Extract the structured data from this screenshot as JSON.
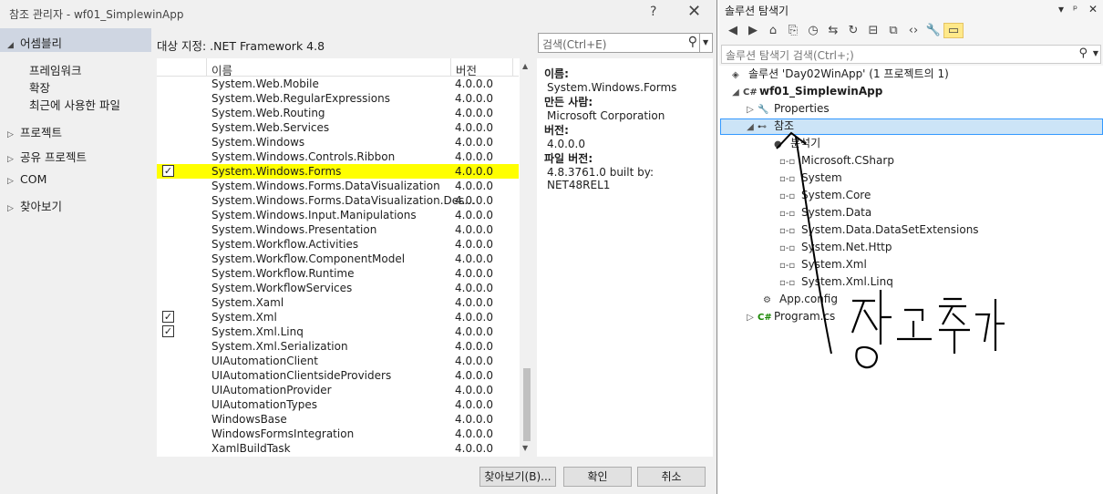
{
  "dialog": {
    "title": "참조 관리자 - wf01_SimplewinApp",
    "help": "?",
    "close": "✕",
    "left_nav": {
      "assemblies": "어셈블리",
      "framework": "프레임워크",
      "extensions": "확장",
      "recent": "최근에 사용한 파일",
      "projects": "프로젝트",
      "shared_projects": "공유 프로젝트",
      "com": "COM",
      "browse": "찾아보기"
    },
    "target_label": "대상 지정: .NET Framework 4.8",
    "search_placeholder": "검색(Ctrl+E)",
    "columns": {
      "name": "이름",
      "version": "버전"
    },
    "rows": [
      {
        "name": "System.Web.Mobile",
        "version": "4.0.0.0",
        "checked": false
      },
      {
        "name": "System.Web.RegularExpressions",
        "version": "4.0.0.0",
        "checked": false
      },
      {
        "name": "System.Web.Routing",
        "version": "4.0.0.0",
        "checked": false
      },
      {
        "name": "System.Web.Services",
        "version": "4.0.0.0",
        "checked": false
      },
      {
        "name": "System.Windows",
        "version": "4.0.0.0",
        "checked": false
      },
      {
        "name": "System.Windows.Controls.Ribbon",
        "version": "4.0.0.0",
        "checked": false
      },
      {
        "name": "System.Windows.Forms",
        "version": "4.0.0.0",
        "checked": true
      },
      {
        "name": "System.Windows.Forms.DataVisualization",
        "version": "4.0.0.0",
        "checked": false
      },
      {
        "name": "System.Windows.Forms.DataVisualization.Des...",
        "version": "4.0.0.0",
        "checked": false
      },
      {
        "name": "System.Windows.Input.Manipulations",
        "version": "4.0.0.0",
        "checked": false
      },
      {
        "name": "System.Windows.Presentation",
        "version": "4.0.0.0",
        "checked": false
      },
      {
        "name": "System.Workflow.Activities",
        "version": "4.0.0.0",
        "checked": false
      },
      {
        "name": "System.Workflow.ComponentModel",
        "version": "4.0.0.0",
        "checked": false
      },
      {
        "name": "System.Workflow.Runtime",
        "version": "4.0.0.0",
        "checked": false
      },
      {
        "name": "System.WorkflowServices",
        "version": "4.0.0.0",
        "checked": false
      },
      {
        "name": "System.Xaml",
        "version": "4.0.0.0",
        "checked": false
      },
      {
        "name": "System.Xml",
        "version": "4.0.0.0",
        "checked": true
      },
      {
        "name": "System.Xml.Linq",
        "version": "4.0.0.0",
        "checked": true
      },
      {
        "name": "System.Xml.Serialization",
        "version": "4.0.0.0",
        "checked": false
      },
      {
        "name": "UIAutomationClient",
        "version": "4.0.0.0",
        "checked": false
      },
      {
        "name": "UIAutomationClientsideProviders",
        "version": "4.0.0.0",
        "checked": false
      },
      {
        "name": "UIAutomationProvider",
        "version": "4.0.0.0",
        "checked": false
      },
      {
        "name": "UIAutomationTypes",
        "version": "4.0.0.0",
        "checked": false
      },
      {
        "name": "WindowsBase",
        "version": "4.0.0.0",
        "checked": false
      },
      {
        "name": "WindowsFormsIntegration",
        "version": "4.0.0.0",
        "checked": false
      },
      {
        "name": "XamlBuildTask",
        "version": "4.0.0.0",
        "checked": false
      }
    ],
    "selected_row": "System.Windows.Forms",
    "highlight_color": "#ffff00",
    "details": {
      "name_label": "이름:",
      "name_value": "System.Windows.Forms",
      "creator_label": "만든 사람:",
      "creator_value": "Microsoft Corporation",
      "version_label": "버전:",
      "version_value": "4.0.0.0",
      "file_version_label": "파일 버전:",
      "file_version_value": "4.8.3761.0 built by: NET48REL1"
    },
    "buttons": {
      "browse": "찾아보기(B)...",
      "ok": "확인",
      "cancel": "취소"
    }
  },
  "solution_explorer": {
    "title": "솔루션 탐색기",
    "search_placeholder": "솔루션 탐색기 검색(Ctrl+;)",
    "tree": {
      "solution": "솔루션 'Day02WinApp' (1 프로젝트의 1)",
      "project": "wf01_SimplewinApp",
      "properties": "Properties",
      "references": "참조",
      "analyzers": "분석기",
      "ref_items": [
        "Microsoft.CSharp",
        "System",
        "System.Core",
        "System.Data",
        "System.Data.DataSetExtensions",
        "System.Net.Http",
        "System.Xml",
        "System.Xml.Linq"
      ],
      "app_config": "App.config",
      "program_cs": "Program.cs"
    }
  },
  "annotation": {
    "handwritten_text": "참조추가",
    "color": "#000000"
  }
}
